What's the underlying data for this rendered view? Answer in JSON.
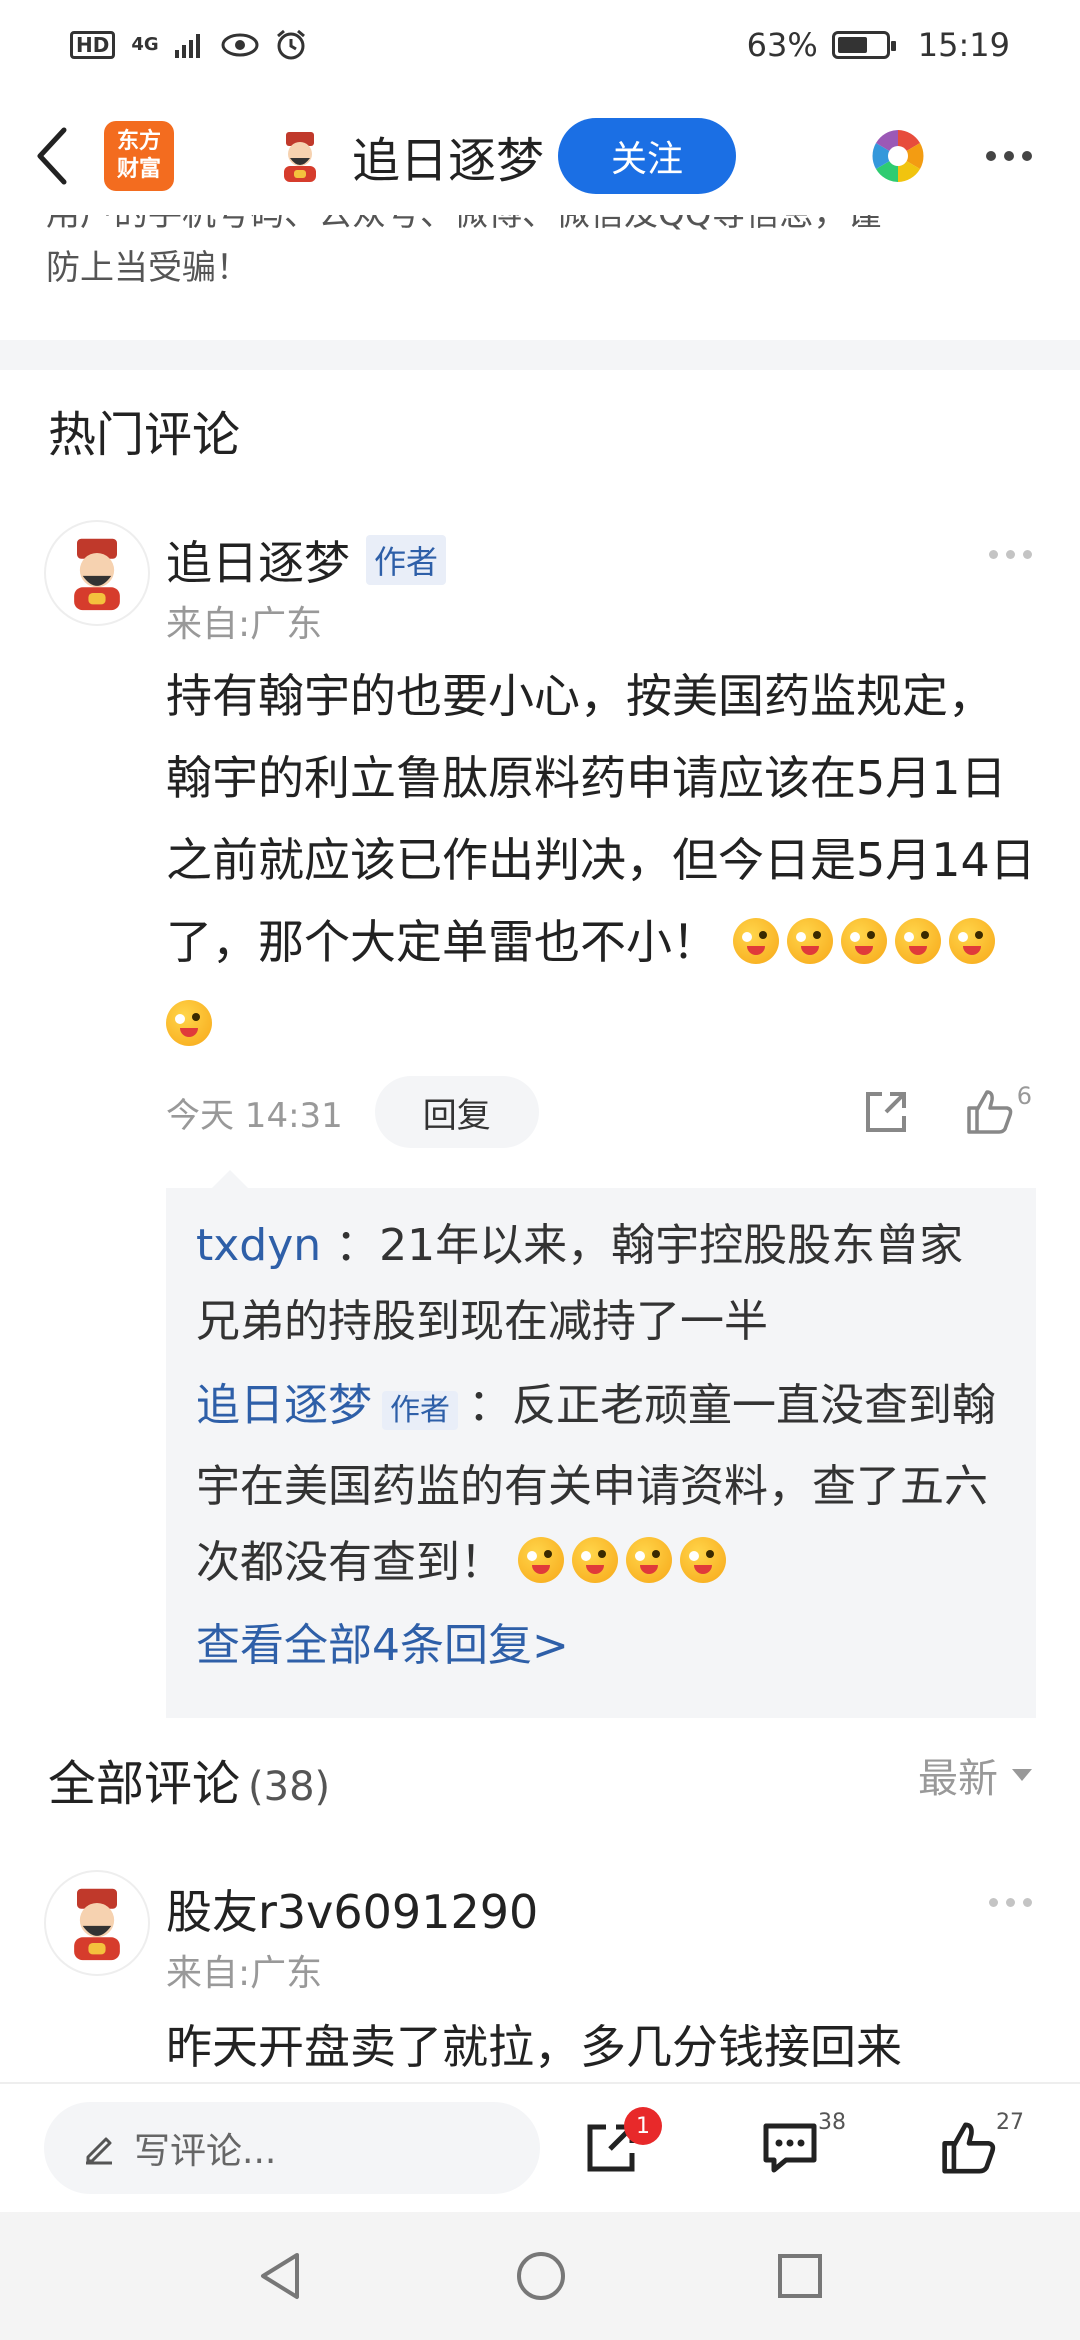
{
  "status_bar": {
    "hd": "HD",
    "signal": "4G",
    "battery": "63%",
    "battery_level": 0.63,
    "time": "15:19"
  },
  "header": {
    "logo_line1": "东方",
    "logo_line2": "财富",
    "user_name": "追日逐梦",
    "follow_label": "关注"
  },
  "notice": {
    "line1": "用户的手机号码、公众号、微博、微信及QQ等信息，谨",
    "line2": "防上当受骗！"
  },
  "hot_section": {
    "title": "热门评论"
  },
  "hot_comment": {
    "user": "追日逐梦",
    "author_tag": "作者",
    "from": "来自:广东",
    "text": "持有翰宇的也要小心，按美国药监规定，翰宇的利立鲁肽原料药申请应该在5月1日之前就应该已作出判决，但今日是5月14日了，那个大定单雷也不小！",
    "emoji_count": 6,
    "time": "今天 14:31",
    "reply_label": "回复",
    "likes": "6",
    "replies": [
      {
        "user": "txdyn",
        "is_author": false,
        "author_tag": "",
        "text": "：21年以来，翰宇控股股东曾家兄弟的持股到现在减持了一半"
      },
      {
        "user": "追日逐梦",
        "is_author": true,
        "author_tag": "作者",
        "text": "：反正老顽童一直没查到翰宇在美国药监的有关申请资料，查了五六次都没有查到！"
      }
    ],
    "view_all": "查看全部4条回复>"
  },
  "all_section": {
    "title": "全部评论",
    "count": "(38)",
    "sort": "最新"
  },
  "comment2": {
    "user": "股友r3v6091290",
    "from": "来自:广东",
    "text": "昨天开盘卖了就拉，多几分钱接回来"
  },
  "bottom_bar": {
    "write_placeholder": "写评论...",
    "share_badge": "1",
    "comments_count": "38",
    "likes_count": "27"
  }
}
